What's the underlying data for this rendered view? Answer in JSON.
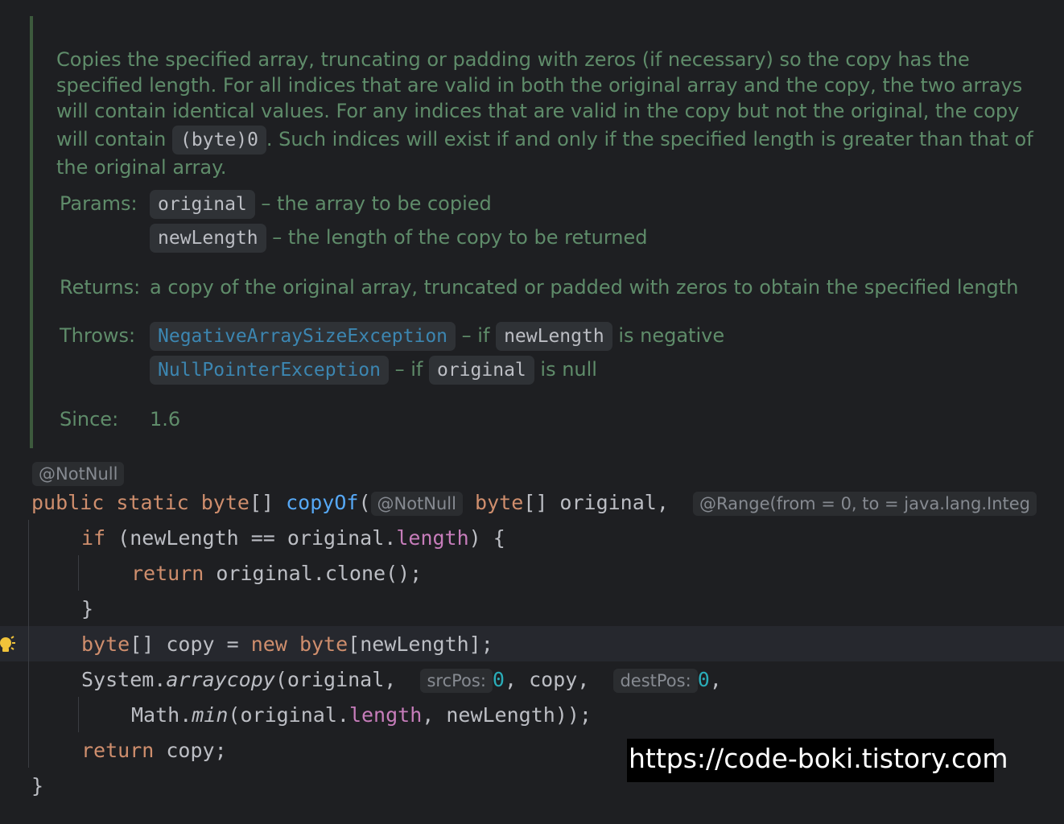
{
  "doc": {
    "para_lines": [
      "Copies the specified array, truncating or padding with zeros (if necessary) so the copy has the",
      "specified length. For all indices that are valid in both the original array and the copy, the two arrays",
      "will contain identical values. For any indices that are valid in the copy but not the original, the copy"
    ],
    "line4_before": "will contain ",
    "line4_code": "(byte)0",
    "line4_after": ". Such indices will exist if and only if the specified length is greater than that of",
    "line5": "the original array.",
    "params_label": "Params:",
    "params": [
      {
        "name": "original",
        "desc": "– the array to be copied"
      },
      {
        "name": "newLength",
        "desc": "– the length of the copy to be returned"
      }
    ],
    "returns_label": "Returns:",
    "returns_text": "a copy of the original array, truncated or padded with zeros to obtain the specified length",
    "throws_label": "Throws:",
    "throws": [
      {
        "exception": "NegativeArraySizeException",
        "if": "– if",
        "param": "newLength",
        "cond": "is negative"
      },
      {
        "exception": "NullPointerException",
        "if": "– if",
        "param": "original",
        "cond": "is null"
      }
    ],
    "since_label": "Since:",
    "since_value": "1.6"
  },
  "code": {
    "annotation": "@NotNull",
    "sig_public": "public",
    "sig_static": "static",
    "sig_byte": "byte",
    "sig_brackets": "[] ",
    "sig_name": "copyOf",
    "sig_paren": "(",
    "param_hint_notnull": "@NotNull",
    "sig_param_type": "byte",
    "sig_param_rest": "[] original, ",
    "range_hint": "@Range(from = 0, to = java.lang.Integ",
    "l2_if": "if",
    "l2_mid": " (newLength == original.",
    "l2_field": "length",
    "l2_end": ") {",
    "l3_return": "return",
    "l3_rest": " original.clone();",
    "l4": "}",
    "l5_byte": "byte",
    "l5_mid": "[] copy = ",
    "l5_new": "new",
    "l5_byte2": "byte",
    "l5_end": "[newLength];",
    "l6_system": "System.",
    "l6_method": "arraycopy",
    "l6_open": "(original, ",
    "hint_srcpos": "srcPos:",
    "l6_zero1": "0",
    "l6_copy": ", copy, ",
    "hint_destpos": "destPos:",
    "l6_zero2": "0",
    "l6_comma": ",",
    "l7_math": "Math.",
    "l7_min": "min",
    "l7_open": "(original.",
    "l7_field": "length",
    "l7_end": ", newLength));",
    "l8_return": "return",
    "l8_rest": " copy;",
    "l9": "}"
  },
  "watermark": "https://code-boki.tistory.com",
  "colors": {
    "background": "#1e1f22",
    "doc_text": "#5f8c6a",
    "keyword": "#cf8e6d",
    "function": "#56a8f5",
    "field": "#c77dbb",
    "number": "#2aacb8",
    "link": "#3c86b1"
  }
}
